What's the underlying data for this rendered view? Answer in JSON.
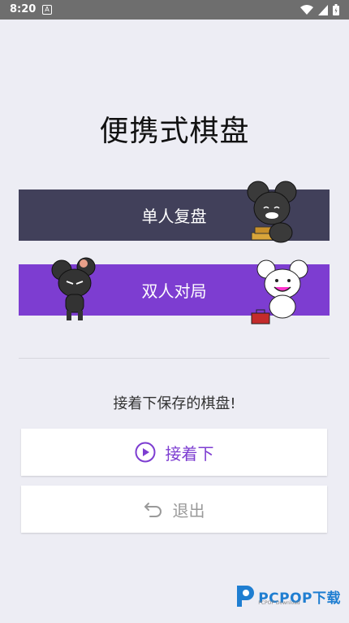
{
  "status_bar": {
    "time": "8:20",
    "notification_icon_letter": "A"
  },
  "app": {
    "title": "便携式棋盘",
    "single_mode_label": "单人复盘",
    "double_mode_label": "双人对局",
    "hint_text": "接着下保存的棋盘!",
    "continue_label": "接着下",
    "exit_label": "退出"
  },
  "watermark": {
    "brand": "PCPOP下载",
    "sub": "PCPOP Download"
  },
  "colors": {
    "background": "#EDEDF4",
    "single_button": "#41405A",
    "double_button": "#7D3DD1",
    "accent": "#7D3DD1",
    "disabled_text": "#9A9A9A"
  },
  "icons": {
    "continue": "play-circle-icon",
    "exit": "undo-arrow-icon"
  }
}
